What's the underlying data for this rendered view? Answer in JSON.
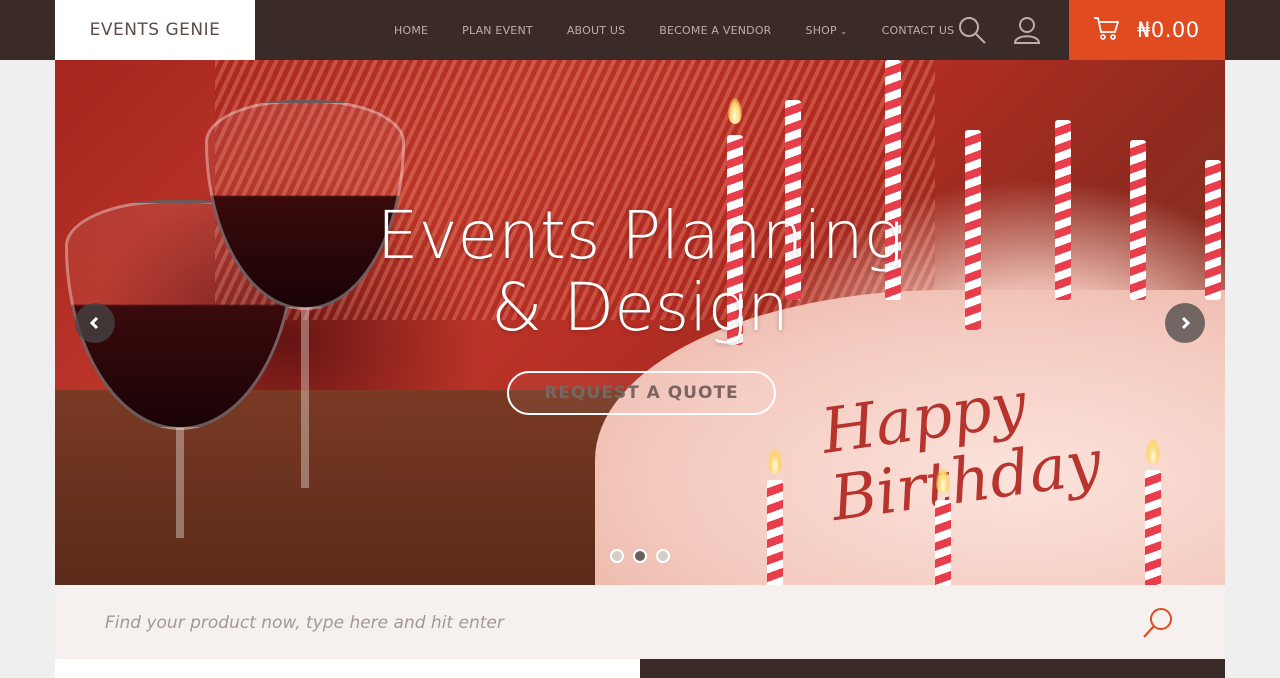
{
  "header": {
    "logo": "EVENTS GENIE",
    "nav": [
      {
        "label": "HOME"
      },
      {
        "label": "PLAN EVENT"
      },
      {
        "label": "ABOUT US"
      },
      {
        "label": "BECOME A VENDOR"
      },
      {
        "label": "SHOP",
        "has_dropdown": true
      },
      {
        "label": "CONTACT US"
      }
    ],
    "icons": [
      "search-icon",
      "user-icon",
      "cart-icon"
    ],
    "cart_total": "₦0.00"
  },
  "hero": {
    "title_line1": "Events Planning",
    "title_line2": "& Design",
    "cta_label": "REQUEST A QUOTE",
    "image_text": "Happy Birthday",
    "slides_count": 3,
    "active_slide": 2
  },
  "search": {
    "placeholder": "Find your product now, type here and hit enter"
  },
  "colors": {
    "header_bg": "#3a2b29",
    "accent": "#e04b1f",
    "nav_text": "#bcaea8",
    "search_bg": "#f6f1ef"
  }
}
